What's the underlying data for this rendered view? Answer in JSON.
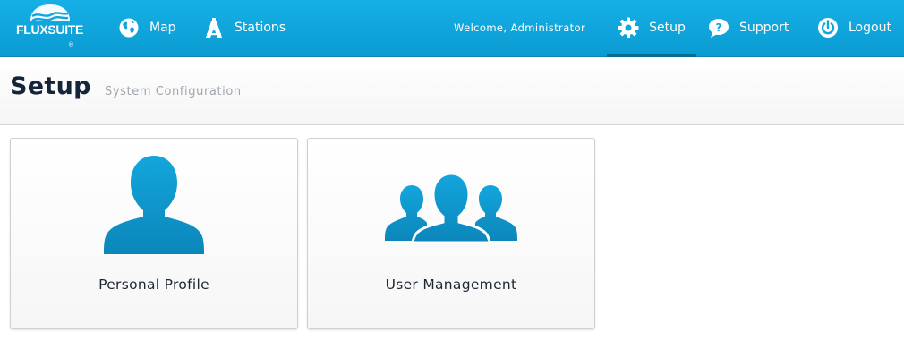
{
  "brand": {
    "name": "FLUXSUITE",
    "registered_mark": "®",
    "color": "#0fa6de"
  },
  "nav": {
    "map_label": "Map",
    "stations_label": "Stations",
    "welcome_text": "Welcome, Administrator",
    "setup_label": "Setup",
    "support_label": "Support",
    "logout_label": "Logout",
    "active_item": "Setup",
    "icons": {
      "map": "globe-icon",
      "stations": "tower-icon",
      "setup": "gear-icon",
      "support": "question-bubble-icon",
      "logout": "power-icon"
    }
  },
  "header": {
    "title": "Setup",
    "subtitle": "System Configuration"
  },
  "cards": [
    {
      "label": "Personal Profile",
      "icon": "person-icon"
    },
    {
      "label": "User Management",
      "icon": "users-icon"
    }
  ],
  "colors": {
    "topbar": "#0fa6de",
    "active_indicator": "#076b93",
    "icon_blue": "#0d93c8",
    "title_text": "#14253a"
  }
}
